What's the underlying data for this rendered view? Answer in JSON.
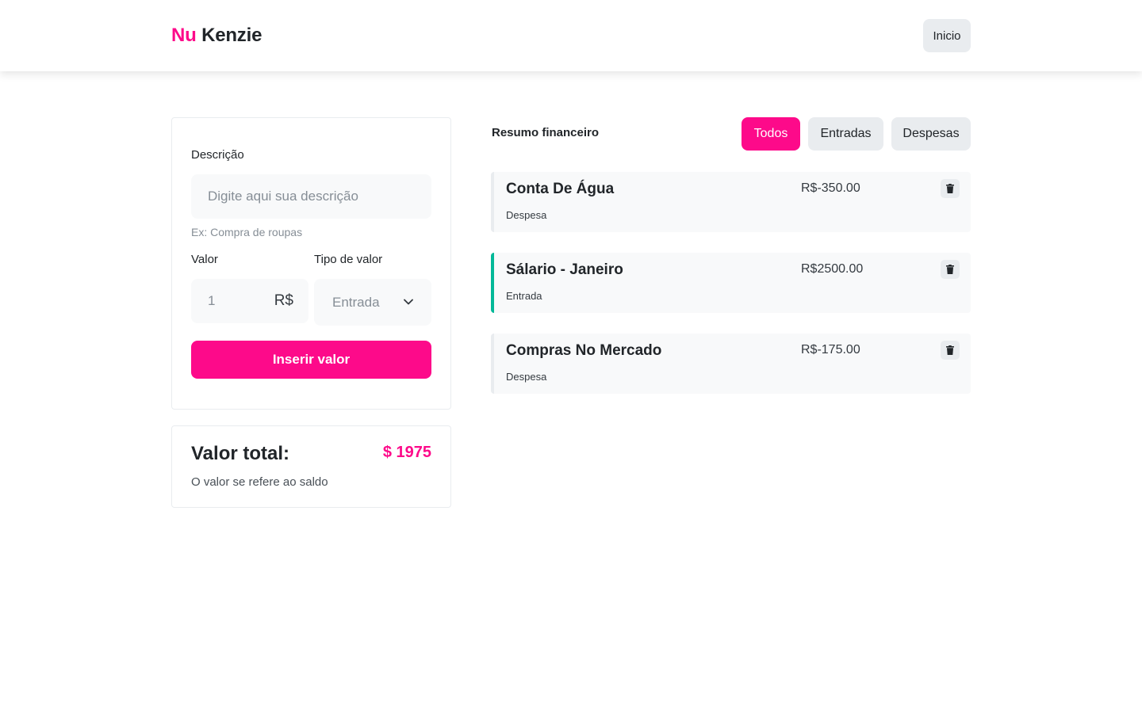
{
  "header": {
    "logo_part1": "Nu",
    "logo_part2": "Kenzie",
    "home_button": "Inicio"
  },
  "form": {
    "description_label": "Descrição",
    "description_placeholder": "Digite aqui sua descrição",
    "description_hint": "Ex: Compra de roupas",
    "value_label": "Valor",
    "value_placeholder": "1",
    "currency": "R$",
    "type_label": "Tipo de valor",
    "type_selected": "Entrada",
    "submit_label": "Inserir valor"
  },
  "total": {
    "title": "Valor total:",
    "value": "$ 1975",
    "note": "O valor se refere ao saldo"
  },
  "summary": {
    "title": "Resumo financeiro",
    "filters": [
      "Todos",
      "Entradas",
      "Despesas"
    ],
    "active_filter": "Todos"
  },
  "entries": [
    {
      "title": "Conta De Água",
      "type": "Despesa",
      "value": "R$-350.00"
    },
    {
      "title": "Sálario - Janeiro",
      "type": "Entrada",
      "value": "R$2500.00"
    },
    {
      "title": "Compras No Mercado",
      "type": "Despesa",
      "value": "R$-175.00"
    }
  ],
  "colors": {
    "brand": "#fd0a8a",
    "income_accent": "#03b898",
    "expense_accent": "#e9ecef"
  },
  "icons": {
    "delete": "trash-icon",
    "select": "chevron-down-icon"
  }
}
